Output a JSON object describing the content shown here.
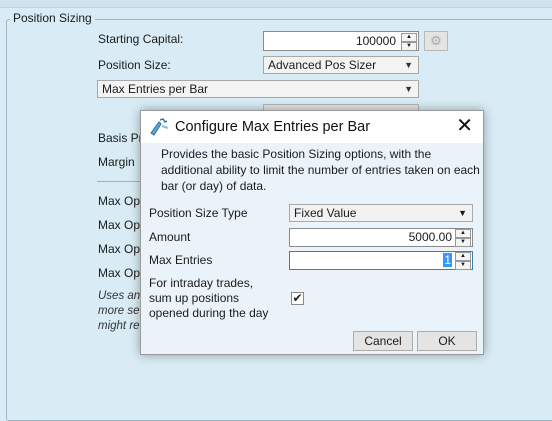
{
  "background_panel": {
    "group_title": "Position Sizing",
    "starting_capital_label": "Starting Capital:",
    "starting_capital_value": "100000",
    "position_size_label": "Position Size:",
    "position_size_value": "Advanced Pos Sizer",
    "sizer_value": "Max Entries per Bar",
    "partial_labels": [
      "Basis Pri",
      "Margin",
      "Max Op",
      "Max Op",
      "Max Op",
      "Max Op"
    ],
    "italic_lines": [
      "Uses an",
      "more se",
      "might re"
    ]
  },
  "dialog": {
    "title": "Configure Max Entries per Bar",
    "description": "Provides the basic Position Sizing options, with the additional ability to limit the number of entries taken on each bar (or day) of data.",
    "position_size_type_label": "Position Size Type",
    "position_size_type_value": "Fixed Value",
    "amount_label": "Amount",
    "amount_value": "5000.00",
    "max_entries_label": "Max Entries",
    "max_entries_value": "1",
    "intraday_label_lines": [
      "For intraday trades,",
      "sum up positions",
      "opened during the day"
    ],
    "intraday_checked": true,
    "cancel_label": "Cancel",
    "ok_label": "OK"
  },
  "icons": {
    "dialog_icon": "wand-icon",
    "close": "close-icon",
    "gear": "gear-icon"
  },
  "colors": {
    "panel_bg": "#d9ecf5",
    "dialog_bg": "#eaf3f9",
    "selection": "#3399ff"
  }
}
